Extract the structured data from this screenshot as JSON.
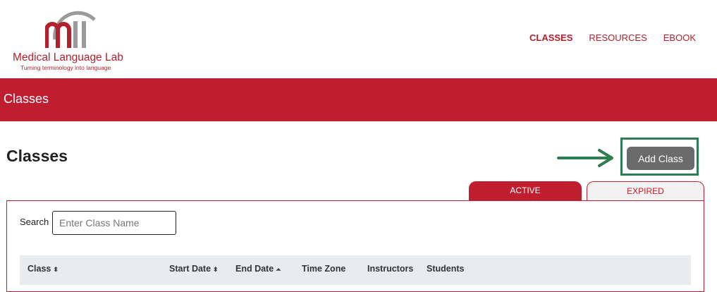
{
  "logo": {
    "mark": "mll",
    "name": "Medical Language Lab",
    "tagline": "Turning terminology into language",
    "colors": {
      "red": "#b3202c",
      "gray": "#9a9a9a"
    }
  },
  "nav": {
    "items": [
      {
        "label": "CLASSES",
        "active": true
      },
      {
        "label": "RESOURCES",
        "active": false
      },
      {
        "label": "EBOOK",
        "active": false
      }
    ]
  },
  "banner": {
    "title": "Classes",
    "color": "#be1e2d"
  },
  "page": {
    "title": "Classes",
    "add_button": "Add Class"
  },
  "annotation": {
    "arrow_color": "#2e7d52",
    "box_color": "#2e7d52"
  },
  "tabs": [
    {
      "label": "ACTIVE",
      "selected": true
    },
    {
      "label": "EXPIRED",
      "selected": false
    }
  ],
  "search": {
    "label": "Search",
    "placeholder": "Enter Class Name",
    "value": ""
  },
  "table": {
    "columns": [
      {
        "label": "Class",
        "sort": "both"
      },
      {
        "label": "Start Date",
        "sort": "both"
      },
      {
        "label": "End Date",
        "sort": "asc"
      },
      {
        "label": "Time Zone",
        "sort": "none"
      },
      {
        "label": "Instructors",
        "sort": "none"
      },
      {
        "label": "Students",
        "sort": "none"
      }
    ],
    "sort_icons": {
      "both": "⬍",
      "asc": "⏶"
    }
  }
}
